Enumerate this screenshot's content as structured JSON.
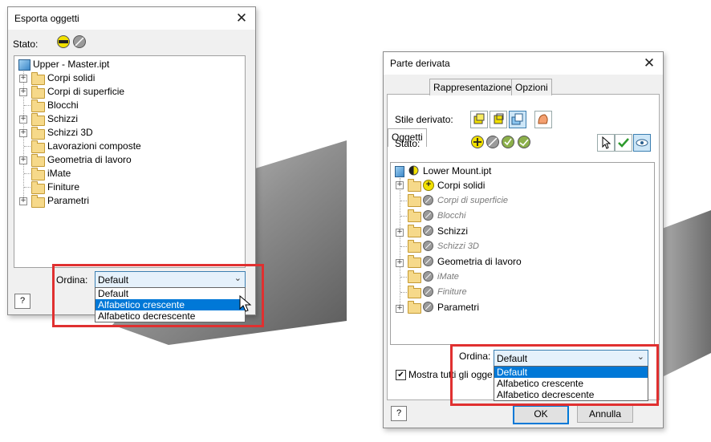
{
  "left_dialog": {
    "title": "Esporta oggetti",
    "close": "✕",
    "stato_label": "Stato:",
    "tree": [
      {
        "label": "Upper - Master.ipt",
        "type": "root"
      },
      {
        "label": "Corpi solidi",
        "expandable": true
      },
      {
        "label": "Corpi di superficie",
        "expandable": true
      },
      {
        "label": "Blocchi",
        "expandable": false
      },
      {
        "label": "Schizzi",
        "expandable": true
      },
      {
        "label": "Schizzi 3D",
        "expandable": true
      },
      {
        "label": "Lavorazioni composte",
        "expandable": false
      },
      {
        "label": "Geometria di lavoro",
        "expandable": true
      },
      {
        "label": "iMate",
        "expandable": false
      },
      {
        "label": "Finiture",
        "expandable": false
      },
      {
        "label": "Parametri",
        "expandable": true
      }
    ],
    "ordina_label": "Ordina:",
    "ordina_value": "Default",
    "options": [
      "Default",
      "Alfabetico crescente",
      "Alfabetico decrescente"
    ],
    "help": "?"
  },
  "right_dialog": {
    "title": "Parte derivata",
    "close": "✕",
    "tabs": [
      "Oggetti",
      "Rappresentazione",
      "Opzioni"
    ],
    "stile_label": "Stile derivato:",
    "stato_label": "Stato:",
    "tree": [
      {
        "label": "Lower Mount.ipt",
        "type": "root"
      },
      {
        "label": "Corpi solidi",
        "expandable": true,
        "status": "plus",
        "dim": false
      },
      {
        "label": "Corpi di superficie",
        "expandable": false,
        "status": "excluded",
        "dim": true
      },
      {
        "label": "Blocchi",
        "expandable": false,
        "status": "excluded",
        "dim": true
      },
      {
        "label": "Schizzi",
        "expandable": true,
        "status": "excluded",
        "dim": false
      },
      {
        "label": "Schizzi 3D",
        "expandable": false,
        "status": "excluded",
        "dim": true
      },
      {
        "label": "Geometria di lavoro",
        "expandable": true,
        "status": "excluded",
        "dim": false
      },
      {
        "label": "iMate",
        "expandable": false,
        "status": "excluded",
        "dim": true
      },
      {
        "label": "Finiture",
        "expandable": false,
        "status": "excluded",
        "dim": true
      },
      {
        "label": "Parametri",
        "expandable": true,
        "status": "excluded",
        "dim": false
      }
    ],
    "ordina_label": "Ordina:",
    "ordina_value": "Default",
    "options": [
      "Default",
      "Alfabetico crescente",
      "Alfabetico decrescente"
    ],
    "mostra_label": "Mostra tutti gli ogge",
    "ok": "OK",
    "cancel": "Annulla",
    "help": "?"
  },
  "colors": {
    "highlight": "#e03030",
    "selection": "#0078d7"
  }
}
